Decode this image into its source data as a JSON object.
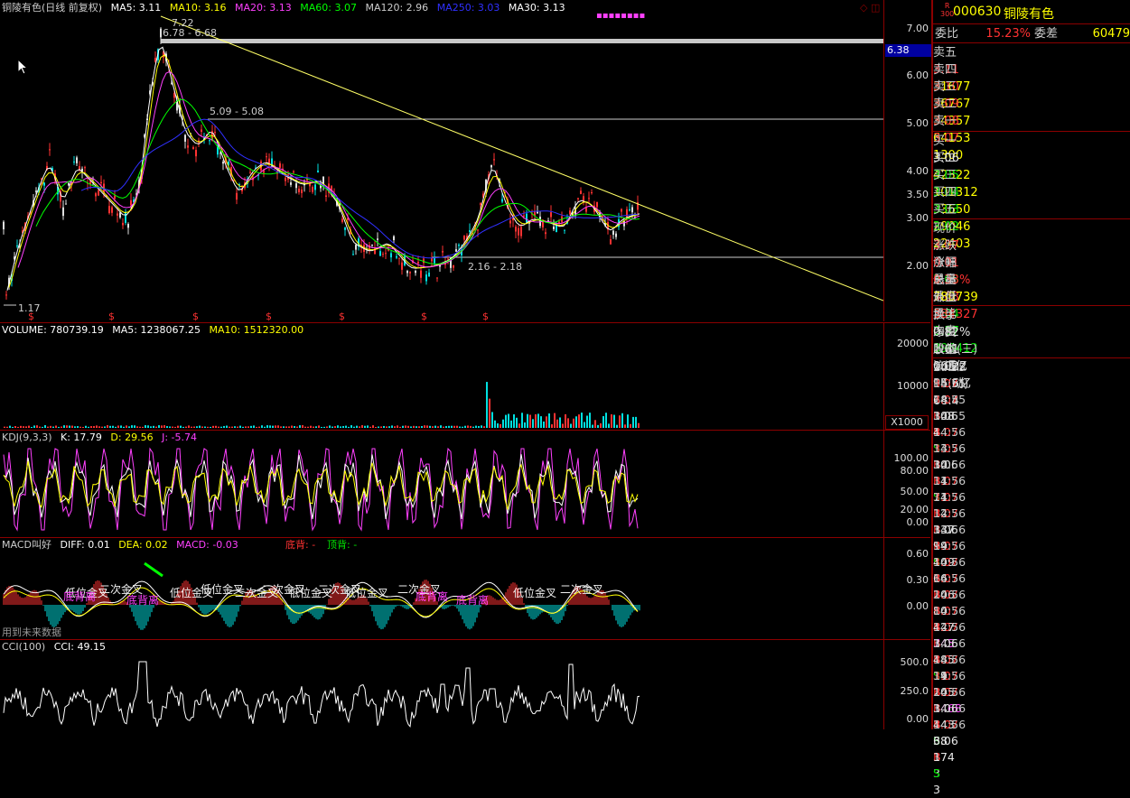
{
  "main_header": {
    "title": "铜陵有色(日线 前复权)",
    "ma5": "MA5: 3.11",
    "ma10": "MA10: 3.16",
    "ma20": "MA20: 3.13",
    "ma60": "MA60: 3.07",
    "ma120": "MA120: 2.96",
    "ma250": "MA250: 3.03",
    "ma30": "MA30: 3.13"
  },
  "price_axis": [
    "7.00",
    "6.00",
    "5.00",
    "4.00",
    "3.50",
    "3.00",
    "2.00"
  ],
  "price_flag": "6.38",
  "annotations": {
    "high": "7.22",
    "low": "1.17",
    "band1": "6.78 - 6.68",
    "band2": "5.09 - 5.08",
    "band3": "2.16 - 2.18",
    "s_marks": [
      "$",
      "$",
      "$",
      "$",
      "$",
      "$",
      "$"
    ]
  },
  "volume": {
    "header": "VOLUME: 780739.19",
    "ma5": "MA5: 1238067.25",
    "ma10": "MA10: 1512320.00",
    "axis": [
      "20000",
      "10000"
    ],
    "unit": "X1000"
  },
  "kdj": {
    "header": "KDJ(9,3,3)",
    "k": "K: 17.79",
    "d": "D: 29.56",
    "j": "J: -5.74",
    "axis": [
      "100.00",
      "80.00",
      "50.00",
      "20.00",
      "0.00"
    ]
  },
  "macd": {
    "header": "MACD叫好",
    "diff": "DIFF: 0.01",
    "dea": "DEA: 0.02",
    "macd": "MACD: -0.03",
    "dibei": "底背: -",
    "dingbei": "顶背: -",
    "axis": [
      "0.60",
      "0.30",
      "0.00"
    ],
    "note": "用到未来数据",
    "signals": [
      "低位金叉",
      "二次金叉",
      "低位金叉",
      "低位金叉",
      "二次金叉",
      "二次金叉",
      "低位金叉",
      "二次金叉",
      "低位金叉",
      "二次金叉",
      "低位金叉",
      "二次金叉"
    ],
    "backs": [
      "底背离",
      "底背离",
      "底背离",
      "底背离"
    ]
  },
  "cci": {
    "header": "CCI(100)",
    "value": "CCI: 49.15",
    "axis": [
      "500.0",
      "250.0",
      "0.00"
    ]
  },
  "quote": {
    "badge_top": "R",
    "badge_bottom": "300",
    "code": "000630",
    "name": "铜陵有色",
    "weibi_label": "委比",
    "weibi": "15.23%",
    "weicha_label": "委差",
    "weicha": "60479",
    "sells": [
      {
        "label": "卖五",
        "price": "3.11",
        "vol": "31677"
      },
      {
        "label": "卖四",
        "price": "3.10",
        "vol": "36767"
      },
      {
        "label": "卖三",
        "price": "3.09",
        "vol": "34357"
      },
      {
        "label": "卖二",
        "price": "3.08",
        "vol": "64153"
      },
      {
        "label": "卖一",
        "price": "3.07",
        "vol": "1300"
      }
    ],
    "buys": [
      {
        "label": "买一",
        "price": "3.06",
        "vol": "42322"
      },
      {
        "label": "买二",
        "price": "3.05",
        "vol": "101312"
      },
      {
        "label": "买三",
        "price": "3.04",
        "vol": "33650"
      },
      {
        "label": "买四",
        "price": "3.03",
        "vol": "29046"
      },
      {
        "label": "买五",
        "price": "3.02",
        "vol": "22403"
      }
    ],
    "stats": [
      {
        "l1": "现价",
        "v1": "3.07",
        "l2": "今开",
        "v2": "3.05"
      },
      {
        "l1": "涨跌",
        "v1": "0.01",
        "l2": "最高",
        "v2": "3.08"
      },
      {
        "l1": "涨幅",
        "v1": "0.33%",
        "l2": "最低",
        "v2": "3.04"
      },
      {
        "l1": "总量",
        "v1": "780739",
        "l2": "量比",
        "v2": "0.57"
      },
      {
        "l1": "外盘",
        "v1": "384327",
        "l2": "内盘",
        "v2": "396412"
      }
    ],
    "stats2": [
      {
        "l1": "换手",
        "v1": "0.82%",
        "l2": "股本",
        "v2": "105亿"
      },
      {
        "l1": "净资",
        "v1": "1.61",
        "l2": "流通",
        "v2": "95.6亿"
      },
      {
        "l1": "收益(三)",
        "v1": "0.022",
        "l2": "PE(动)",
        "v2": "68.4"
      }
    ],
    "trades": [
      {
        "t": "14:55",
        "p": "3.07",
        "v": "2",
        "bs": "B",
        "n": "1"
      },
      {
        "t": "14:55",
        "p": "3.07",
        "v": "108",
        "bs": "B",
        "n": "3"
      },
      {
        "t": "14:55",
        "p": "3.06",
        "v": "4",
        "bs": "S",
        "n": "1"
      },
      {
        "t": "14:55",
        "p": "3.07",
        "v": "33",
        "bs": "B",
        "n": "3"
      },
      {
        "t": "14:56",
        "p": "3.07",
        "v": "30",
        "bs": "B",
        "n": "3"
      },
      {
        "t": "14:56",
        "p": "3.06",
        "v": "31",
        "bs": "S",
        "n": "3"
      },
      {
        "t": "14:56",
        "p": "3.07",
        "v": "71",
        "bs": "B",
        "n": "3"
      },
      {
        "t": "14:56",
        "p": "3.07",
        "v": "12",
        "bs": "B",
        "n": "1"
      },
      {
        "t": "14:56",
        "p": "3.07",
        "v": "137",
        "bs": "B",
        "n": "4"
      },
      {
        "t": "14:56",
        "p": "3.06",
        "v": "99",
        "bs": "S",
        "n": "3"
      },
      {
        "t": "14:56",
        "p": "3.07",
        "v": "109",
        "bs": "B",
        "n": "3"
      },
      {
        "t": "14:56",
        "p": "3.07",
        "v": "66",
        "bs": "B",
        "n": "3"
      },
      {
        "t": "14:56",
        "p": "3.07",
        "v": "206",
        "bs": "B",
        "n": "3"
      },
      {
        "t": "14:56",
        "p": "3.07",
        "v": "80",
        "bs": "B",
        "n": "3"
      },
      {
        "t": "14:56",
        "p": "3.07",
        "v": "427",
        "bs": "B",
        "n": "3"
      },
      {
        "t": "14:56",
        "p": "3.07",
        "v": "745",
        "bs": "B",
        "n": "19"
      },
      {
        "t": "14:56",
        "p": "3.06",
        "v": "485",
        "bs": "S",
        "n": "14"
      },
      {
        "t": "14:56",
        "p": "3.07",
        "v": "31",
        "bs": "B",
        "n": "3"
      },
      {
        "t": "14:56",
        "p": "3.07",
        "v": "205",
        "bs": "B",
        "n": "3"
      },
      {
        "t": "14:56",
        "p": "3.07",
        "v": "1468",
        "bs": "B",
        "n": "3"
      },
      {
        "t": "14:56",
        "p": "3.06",
        "v": "443",
        "bs": "S",
        "n": "3"
      },
      {
        "t": "14:56",
        "p": "3.07",
        "v": "68",
        "bs": "B",
        "n": "3"
      },
      {
        "t": "14:56",
        "p": "3.06",
        "v": "174",
        "bs": "S",
        "n": "3"
      }
    ]
  },
  "colors": {
    "up": "#ff3232",
    "down": "#00e600",
    "ma5": "#ffffff",
    "ma10": "#ffff00",
    "ma20": "#ff40ff",
    "ma60": "#00ff00",
    "ma250": "#3030ff",
    "trend": "#ffff66",
    "border": "#8b0000"
  }
}
